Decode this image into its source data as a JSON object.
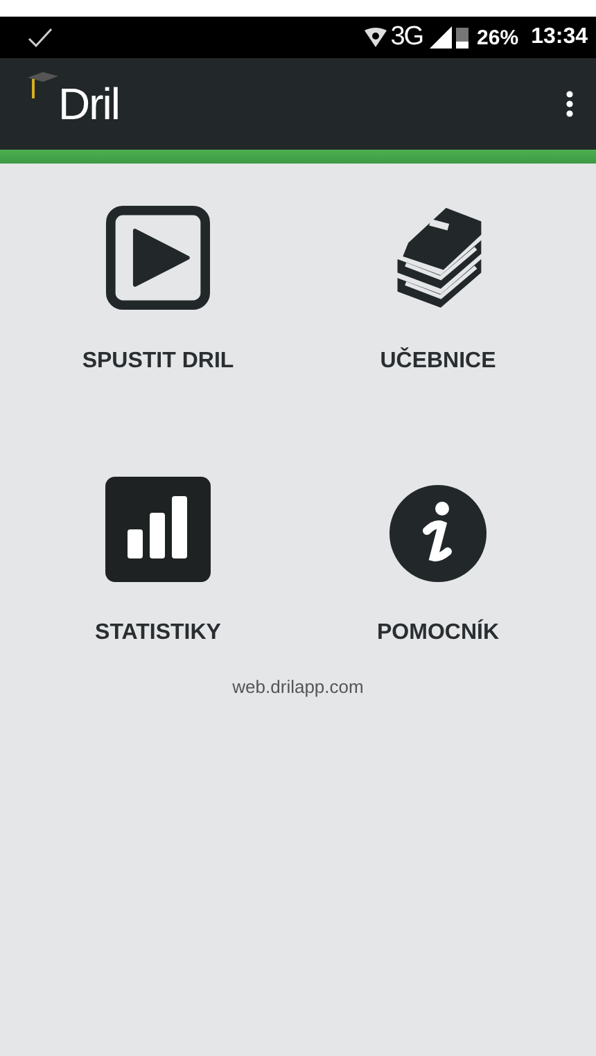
{
  "status_bar": {
    "battery": "26%",
    "network": "3G",
    "time": "13:34"
  },
  "app_bar": {
    "title": "Dril"
  },
  "menu_items": [
    {
      "kind": "play",
      "label": "SPUSTIT DRIL"
    },
    {
      "kind": "books",
      "label": "UČEBNICE"
    },
    {
      "kind": "chart",
      "label": "STATISTIKY"
    },
    {
      "kind": "info",
      "label": "POMOCNÍK"
    }
  ],
  "footer_link": "web.drilapp.com"
}
